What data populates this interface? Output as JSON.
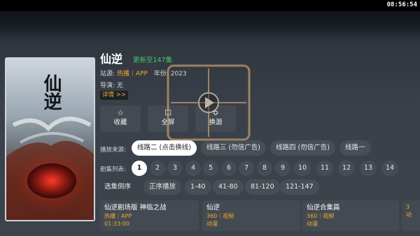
{
  "status_bar": {
    "clock": "08:56:54"
  },
  "detail": {
    "title": "仙逆",
    "update_status": "更新至147集",
    "site_label": "站源:",
    "site_value": "热播｜APP",
    "year_label": "年份:",
    "year_value": "2023",
    "director_label": "导演:",
    "director_value": "无",
    "details_link": "详情 >>"
  },
  "actions": [
    {
      "label": "收藏",
      "icon": "star-icon"
    },
    {
      "label": "全屏",
      "icon": "fullscreen-icon"
    },
    {
      "label": "换源",
      "icon": "swap-icon"
    }
  ],
  "sources": {
    "label": "播放来源:",
    "items": [
      "线路二 (点击换线)",
      "线路三 (勿信广告)",
      "线路四 (勿信广告)",
      "线路一"
    ],
    "selected_index": 0
  },
  "episodes": {
    "label": "剧集列表:",
    "items": [
      "1",
      "2",
      "3",
      "4",
      "5",
      "6",
      "7",
      "8",
      "9",
      "10",
      "11",
      "12",
      "13",
      "14"
    ],
    "selected_index": 0
  },
  "episode_controls": {
    "items": [
      "选集倒序",
      "正序播放",
      "1-40",
      "41-80",
      "81-120",
      "121-147"
    ]
  },
  "related": [
    {
      "name": "仙逆剧场版 神临之战",
      "source": "热播｜APP",
      "extra": "01:33:00"
    },
    {
      "name": "仙逆",
      "source": "360｜视频",
      "extra": "动漫"
    },
    {
      "name": "仙逆合集篇",
      "source": "360｜视频",
      "extra": "动漫"
    },
    {
      "name": "",
      "source": "3",
      "extra": "动"
    }
  ],
  "colors": {
    "accent_orange": "#f0a830",
    "update_green": "#46c86a",
    "selected_pill": "#ffffff"
  }
}
